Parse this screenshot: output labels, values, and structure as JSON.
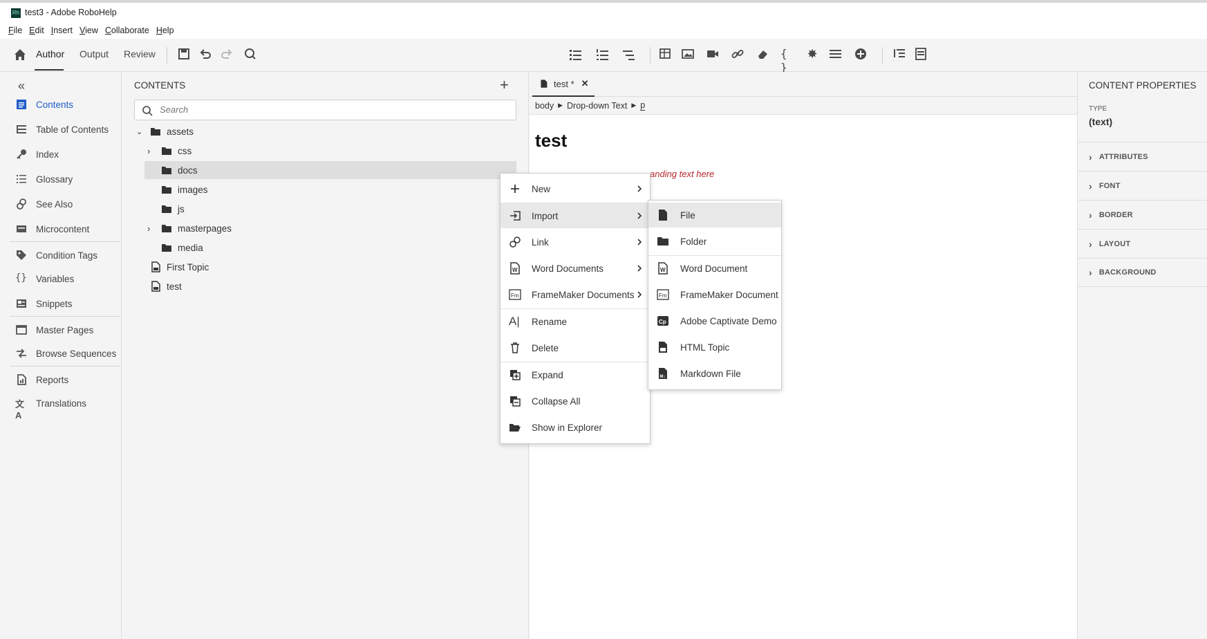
{
  "window": {
    "title": "test3 - Adobe RoboHelp",
    "app_icon_text": "Rh"
  },
  "menubar": [
    "File",
    "Edit",
    "Insert",
    "View",
    "Collaborate",
    "Help"
  ],
  "modes": {
    "author": "Author",
    "output": "Output",
    "review": "Review"
  },
  "leftnav": {
    "items": [
      {
        "label": "Contents",
        "icon": "contents-icon"
      },
      {
        "label": "Table of Contents",
        "icon": "toc-icon"
      },
      {
        "label": "Index",
        "icon": "key-icon"
      },
      {
        "label": "Glossary",
        "icon": "glossary-icon"
      },
      {
        "label": "See Also",
        "icon": "see-also-icon"
      },
      {
        "label": "Microcontent",
        "icon": "microcontent-icon"
      },
      {
        "label": "Condition Tags",
        "icon": "tag-icon"
      },
      {
        "label": "Variables",
        "icon": "braces-icon"
      },
      {
        "label": "Snippets",
        "icon": "snippets-icon"
      },
      {
        "label": "Master Pages",
        "icon": "master-pages-icon"
      },
      {
        "label": "Browse Sequences",
        "icon": "browse-sequences-icon"
      },
      {
        "label": "Reports",
        "icon": "reports-icon"
      },
      {
        "label": "Translations",
        "icon": "translations-icon"
      }
    ]
  },
  "contents": {
    "title": "CONTENTS",
    "search_placeholder": "Search",
    "tree": [
      {
        "label": "assets",
        "type": "folder"
      },
      {
        "label": "css",
        "type": "folder"
      },
      {
        "label": "docs",
        "type": "folder"
      },
      {
        "label": "images",
        "type": "folder"
      },
      {
        "label": "js",
        "type": "folder"
      },
      {
        "label": "masterpages",
        "type": "folder"
      },
      {
        "label": "media",
        "type": "folder"
      },
      {
        "label": "First Topic",
        "type": "topic"
      },
      {
        "label": "test",
        "type": "topic"
      }
    ]
  },
  "editor": {
    "tab_label": "test *",
    "breadcrumb": [
      "body",
      "Drop-down Text",
      "p"
    ],
    "heading": "test",
    "dropdown_text": "anding text here",
    "accent_color": "#b5272d"
  },
  "properties": {
    "title": "CONTENT PROPERTIES",
    "type_label": "TYPE",
    "type_value": "(text)",
    "sections": [
      "ATTRIBUTES",
      "FONT",
      "BORDER",
      "LAYOUT",
      "BACKGROUND"
    ]
  },
  "context_menu": {
    "items": [
      {
        "label": "New",
        "icon": "plus-icon",
        "submenu": true
      },
      {
        "label": "Import",
        "icon": "import-icon",
        "submenu": true
      },
      {
        "label": "Link",
        "icon": "link-icon",
        "submenu": true
      },
      {
        "label": "Word Documents",
        "icon": "word-icon",
        "submenu": true
      },
      {
        "label": "FrameMaker Documents",
        "icon": "framemaker-icon",
        "submenu": true
      },
      {
        "label": "Rename",
        "icon": "rename-icon",
        "submenu": false
      },
      {
        "label": "Delete",
        "icon": "trash-icon",
        "submenu": false
      },
      {
        "label": "Expand",
        "icon": "expand-icon",
        "submenu": false
      },
      {
        "label": "Collapse All",
        "icon": "collapse-all-icon",
        "submenu": false
      },
      {
        "label": "Show in Explorer",
        "icon": "open-folder-icon",
        "submenu": false
      }
    ]
  },
  "import_submenu": {
    "items": [
      {
        "label": "File",
        "icon": "file-icon"
      },
      {
        "label": "Folder",
        "icon": "folder-icon"
      },
      {
        "label": "Word Document",
        "icon": "word-doc-icon"
      },
      {
        "label": "FrameMaker Document",
        "icon": "framemaker-doc-icon"
      },
      {
        "label": "Adobe Captivate Demo",
        "icon": "captivate-icon"
      },
      {
        "label": "HTML Topic",
        "icon": "html-topic-icon"
      },
      {
        "label": "Markdown File",
        "icon": "markdown-icon"
      }
    ]
  }
}
